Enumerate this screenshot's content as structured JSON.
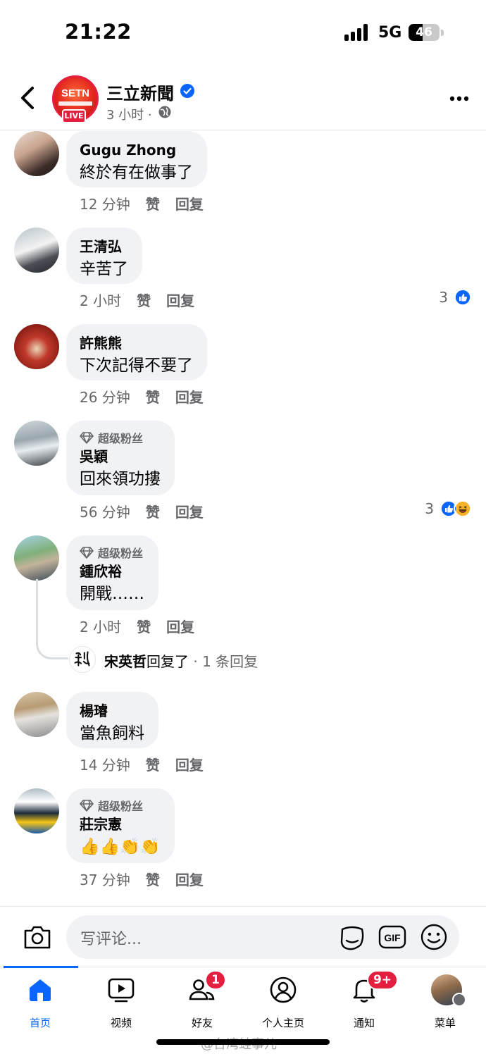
{
  "status_bar": {
    "time": "21:22",
    "network": "5G",
    "battery": "46",
    "battery_level": 0.46
  },
  "header": {
    "page_name": "三立新聞",
    "post_time": "3 小时 ·",
    "avatar_text": "SETN",
    "live_label": "LIVE"
  },
  "comments": [
    {
      "name": "Gugu Zhong",
      "text": "終於有在做事了",
      "time": "12 分钟",
      "like": "赞",
      "reply": "回复",
      "fan_label": "",
      "reaction_count": ""
    },
    {
      "name": "王清弘",
      "text": "辛苦了",
      "time": "2 小时",
      "like": "赞",
      "reply": "回复",
      "fan_label": "",
      "reaction_count": "3"
    },
    {
      "name": "許熊熊",
      "text": "下次記得不要了",
      "time": "26 分钟",
      "like": "赞",
      "reply": "回复",
      "fan_label": "",
      "reaction_count": ""
    },
    {
      "name": "吳穎",
      "text": "回來領功摟",
      "time": "56 分钟",
      "like": "赞",
      "reply": "回复",
      "fan_label": "超级粉丝",
      "reaction_count": "3"
    },
    {
      "name": "鍾欣裕",
      "text": "開戰……",
      "time": "2 小时",
      "like": "赞",
      "reply": "回复",
      "fan_label": "超级粉丝",
      "reaction_count": ""
    },
    {
      "name": "楊璿",
      "text": "當魚飼料",
      "time": "14 分钟",
      "like": "赞",
      "reply": "回复",
      "fan_label": "",
      "reaction_count": ""
    },
    {
      "name": "莊宗憲",
      "text": "👍👍👏👏",
      "time": "37 分钟",
      "like": "赞",
      "reply": "回复",
      "fan_label": "超级粉丝",
      "reaction_count": ""
    }
  ],
  "reply_summary": {
    "name": "宋英哲",
    "action": "回复了",
    "count": " · 1 条回复"
  },
  "composer": {
    "placeholder": "写评论..."
  },
  "tabs": [
    {
      "label": "首页",
      "icon": "home-icon",
      "badge": ""
    },
    {
      "label": "视频",
      "icon": "video-icon",
      "badge": ""
    },
    {
      "label": "好友",
      "icon": "friends-icon",
      "badge": "1"
    },
    {
      "label": "个人主页",
      "icon": "profile-icon",
      "badge": ""
    },
    {
      "label": "通知",
      "icon": "bell-icon",
      "badge": "9+"
    },
    {
      "label": "菜单",
      "icon": "menu-avatar",
      "badge": ""
    }
  ],
  "watermark": "@台湾蛙事儿",
  "colors": {
    "accent": "#0866ff",
    "badge": "#e41e3f",
    "bubble": "#f0f2f5",
    "secondary_text": "#65676b"
  }
}
